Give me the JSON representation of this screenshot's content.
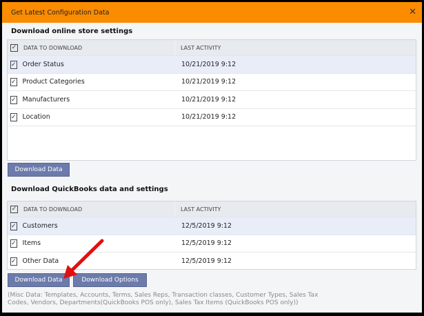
{
  "dialog": {
    "title": "Get Latest Configuration Data",
    "close": "✕"
  },
  "store": {
    "heading": "Download online store settings",
    "columns": [
      "DATA TO DOWNLOAD",
      "LAST ACTIVITY"
    ],
    "rows": [
      {
        "name": "Order Status",
        "date": "10/21/2019 9:12"
      },
      {
        "name": "Product Categories",
        "date": "10/21/2019 9:12"
      },
      {
        "name": "Manufacturers",
        "date": "10/21/2019 9:12"
      },
      {
        "name": "Location",
        "date": "10/21/2019 9:12"
      }
    ],
    "download_label": "Download Data"
  },
  "qb": {
    "heading": "Download QuickBooks data and settings",
    "columns": [
      "DATA TO DOWNLOAD",
      "LAST ACTIVITY"
    ],
    "rows": [
      {
        "name": "Customers",
        "date": "12/5/2019 9:12"
      },
      {
        "name": "Items",
        "date": "12/5/2019 9:12"
      },
      {
        "name": "Other Data",
        "date": "12/5/2019 9:12"
      }
    ],
    "download_label": "Download Data",
    "options_label": "Download Options",
    "misc": "(Misc Data: Templates, Accounts, Terms, Sales Reps, Transaction classes, Customer Types, Sales Tax Codes, Vendors, Departments(QuickBooks POS only), Sales Tax Items (QuickBooks POS only))"
  },
  "check": "✓"
}
